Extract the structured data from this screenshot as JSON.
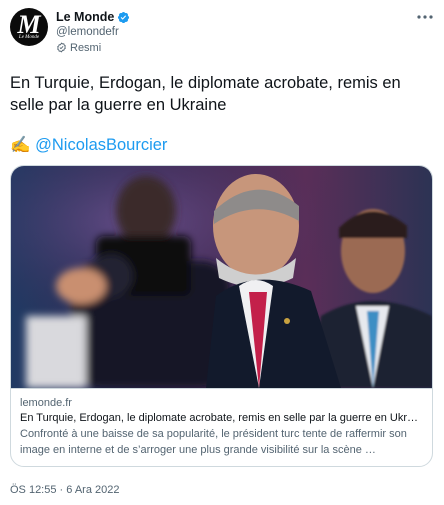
{
  "account": {
    "avatar_letter": "M",
    "avatar_caption": "Le Monde",
    "display_name": "Le Monde",
    "handle": "@lemondefr",
    "official_label": "Resmi",
    "verified_icon": "verified-badge-icon",
    "colors": {
      "verified": "#1d9bf0",
      "secondary_text": "#536471"
    }
  },
  "tweet": {
    "text": "En Turquie, Erdogan, le diplomate acrobate, remis en selle par la guerre en Ukraine",
    "author_emoji": "✍️",
    "author_mention": "@NicolasBourcier",
    "mention_color": "#1d9bf0"
  },
  "card": {
    "image_description_icon": "photo",
    "domain": "lemonde.fr",
    "title": "En Turquie, Erdogan, le diplomate acrobate, remis en selle par la guerre en Ukraine",
    "description": "Confronté à une baisse de sa popularité, le président turc tente de raffermir son image en interne et de s’arroger une plus grande visibilité sur la scène …"
  },
  "footer": {
    "timestamp": "ÖS 12:55 · 6 Ara 2022"
  }
}
